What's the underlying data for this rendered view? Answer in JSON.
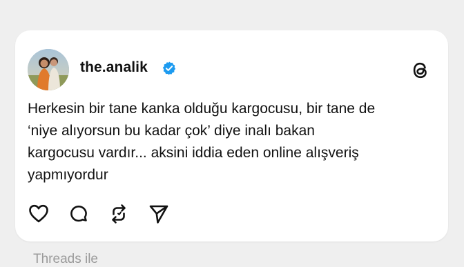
{
  "post": {
    "username": "the.analik",
    "lines": [
      "Herkesin bir tane kanka olduğu kargocusu, bir tane de",
      "‘niye alıyorsun bu kadar çok’ diye inalı bakan",
      "kargocusu vardır... aksini iddia eden online alışveriş",
      "yapmıyordur"
    ]
  },
  "icons": {
    "verified": "verified-badge-icon",
    "app_logo": "threads-logo-icon",
    "like": "heart-icon",
    "reply": "comment-bubble-icon",
    "repost": "repost-icon",
    "share": "send-icon"
  },
  "colors": {
    "verified": "#1d9bf0",
    "text": "#111111",
    "background": "#efefef",
    "card": "#ffffff"
  },
  "footer": {
    "text": "Threads ile"
  }
}
